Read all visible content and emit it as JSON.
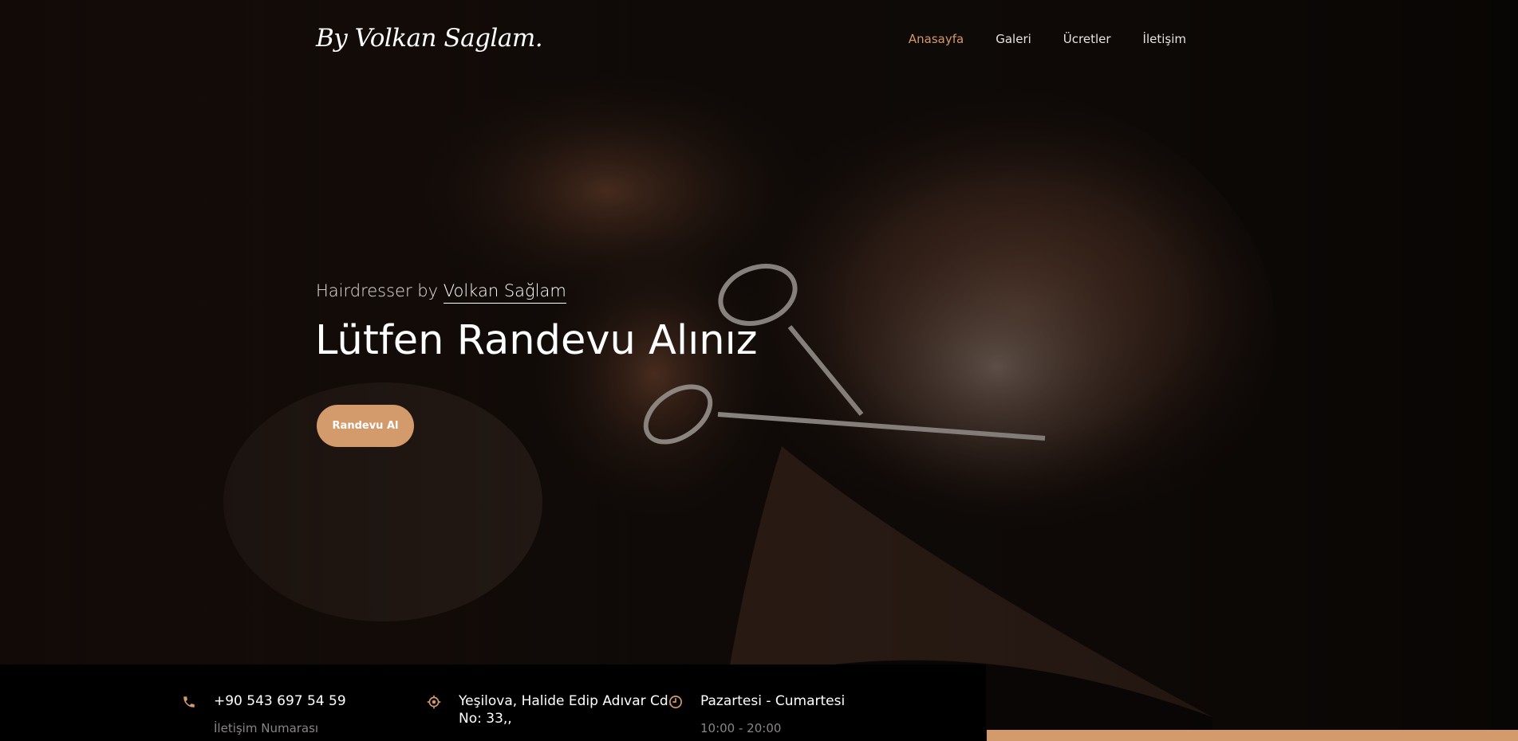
{
  "brand": {
    "logo_text": "By Volkan Saglam."
  },
  "nav": {
    "items": [
      {
        "label": "Anasayfa",
        "active": true
      },
      {
        "label": "Galeri",
        "active": false
      },
      {
        "label": "Ücretler",
        "active": false
      },
      {
        "label": "İletişim",
        "active": false
      }
    ]
  },
  "hero": {
    "subtitle_prefix": "Hairdresser by",
    "subtitle_name": "Volkan Sağlam",
    "headline": "Lütfen Randevu Alınız",
    "cta_label": "Randevu Al"
  },
  "info": {
    "phone": {
      "icon": "phone-icon",
      "title": "+90 543 697 54 59",
      "sub": "İletişim Numarası"
    },
    "address": {
      "icon": "location-icon",
      "line1": "Yeşilova, Halide Edip Adıvar Cd.",
      "line2": "No: 33,,"
    },
    "hours": {
      "icon": "clock-icon",
      "title": "Pazartesi - Cumartesi",
      "sub": "10:00 - 20:00"
    }
  },
  "colors": {
    "accent": "#d39b6c",
    "nav_active": "#d4996a",
    "info_bar_bg": "#000000",
    "hero_bg": "#0f0a08"
  }
}
